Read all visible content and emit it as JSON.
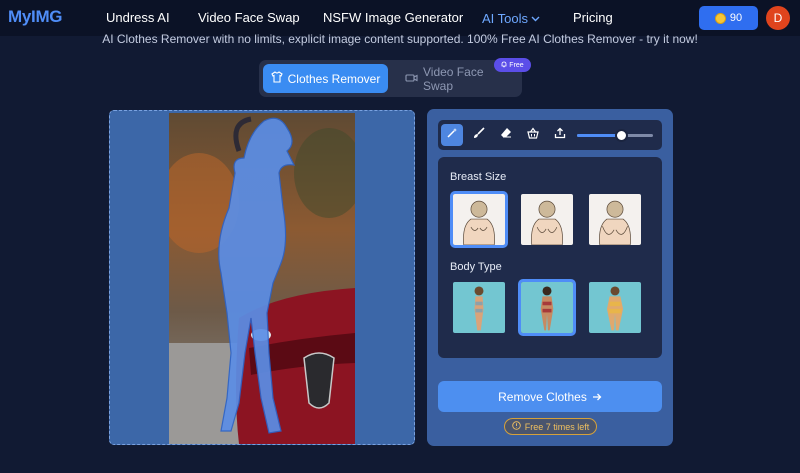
{
  "nav": {
    "logo": "MyIMG",
    "links": [
      "Undress AI",
      "Video Face Swap",
      "NSFW Image Generator",
      "AI Tools",
      "Pricing"
    ],
    "credits": "90",
    "avatar_letter": "D"
  },
  "subtitle": "AI Clothes Remover with no limits, explicit image content supported. 100% Free AI Clothes Remover - try it now!",
  "tabs": {
    "active": "Clothes Remover",
    "inactive": "Video Face Swap",
    "badge": "Free"
  },
  "tools": {
    "items": [
      "magic-wand-icon",
      "brush-icon",
      "eraser-icon",
      "basket-icon",
      "upload-icon"
    ],
    "brush_size": 0.58,
    "breast_size_label": "Breast Size",
    "body_type_label": "Body Type",
    "breast_size_options": 3,
    "breast_size_selected": 0,
    "body_type_options": 3,
    "body_type_selected": 1
  },
  "action": {
    "label": "Remove Clothes",
    "free_left": "Free 7 times left"
  },
  "colors": {
    "accent": "#3a8cf2",
    "background": "#111a33",
    "badge": "#5b4ee8",
    "avatar": "#e0441d"
  }
}
